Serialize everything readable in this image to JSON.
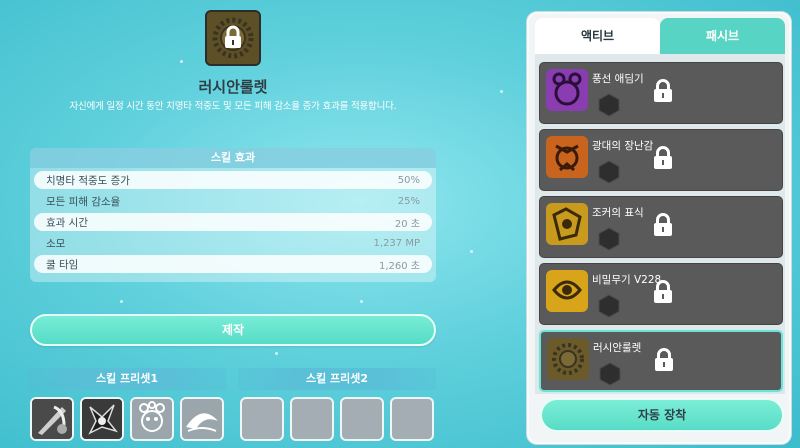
{
  "skill": {
    "name": "러시안룰렛",
    "description": "자신에게 일정 시간 동안 치명타 적중도 및 모든 피해 감소율 증가 효과를 적용합니다.",
    "icon": "locked-roulette-icon"
  },
  "effects": {
    "title": "스킬 효과",
    "rows": [
      {
        "label": "치명타 적중도 증가",
        "value": "50%"
      },
      {
        "label": "모든 피해 감소율",
        "value": "25%"
      },
      {
        "label": "효과 시간",
        "value": "20 초"
      },
      {
        "label": "소모",
        "value": "1,237 MP"
      },
      {
        "label": "쿨 타임",
        "value": "1,260 초"
      }
    ]
  },
  "craft_button": "제작",
  "presets": [
    {
      "title": "스킬 프리셋1"
    },
    {
      "title": "스킬 프리셋2"
    }
  ],
  "tabs": {
    "active": "액티브",
    "passive": "패시브"
  },
  "skill_list": [
    {
      "name": "풍선 애딤기",
      "color": "#8a3db0",
      "locked": true
    },
    {
      "name": "광대의 장난감",
      "color": "#c8641e",
      "locked": true
    },
    {
      "name": "조커의 표식",
      "color": "#c89a1e",
      "locked": true
    },
    {
      "name": "비밀무기 V228",
      "color": "#d8a41a",
      "locked": true
    },
    {
      "name": "러시안룰렛",
      "color": "#6b5a2a",
      "locked": true,
      "selected": true
    }
  ],
  "auto_equip_button": "자동 장착"
}
